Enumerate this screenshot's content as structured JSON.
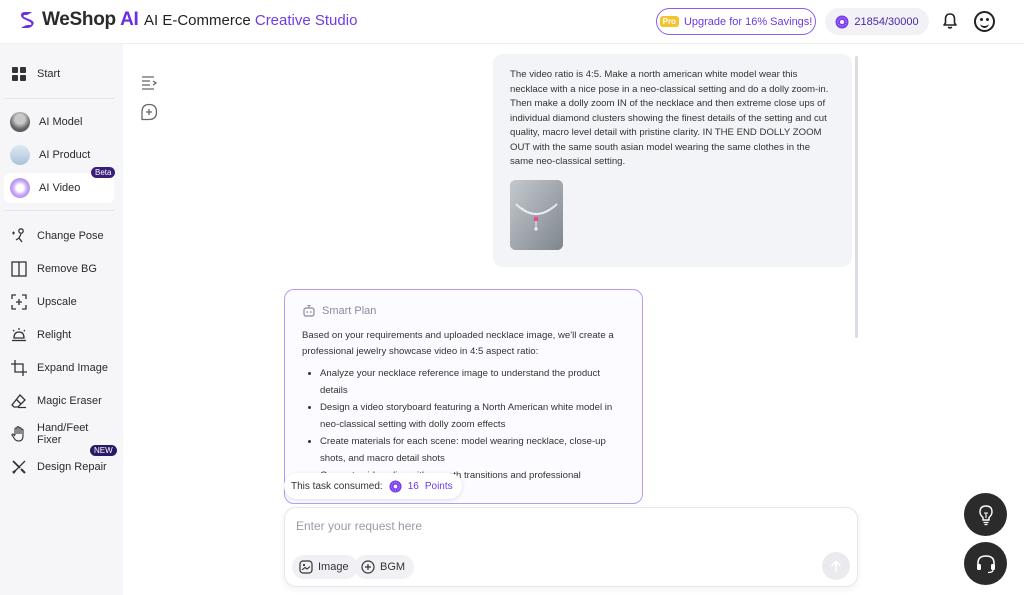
{
  "header": {
    "logo_we": "WeShop",
    "logo_ai": "AI",
    "title_main": "AI E-Commerce",
    "title_accent": "Creative Studio",
    "upgrade_pro": "Pro",
    "upgrade_label": "Upgrade for 16% Savings!",
    "points": "21854/30000"
  },
  "sidebar": {
    "start": "Start",
    "ai_model": "AI Model",
    "ai_product": "AI Product",
    "ai_video": "AI Video",
    "ai_video_badge": "Beta",
    "change_pose": "Change Pose",
    "remove_bg": "Remove BG",
    "upscale": "Upscale",
    "relight": "Relight",
    "expand_image": "Expand Image",
    "magic_eraser": "Magic Eraser",
    "hand_feet_fixer": "Hand/Feet Fixer",
    "design_repair": "Design Repair",
    "design_repair_badge": "NEW"
  },
  "chat": {
    "user_message": "The video ratio is 4:5. Make a north american white model wear this necklace with a nice pose in a neo-classical setting and do a dolly zoom-in. Then make a dolly zoom IN of the necklace and then extreme close ups of individual diamond clusters showing the finest details of the setting and cut quality, macro level detail with pristine clarity. IN THE END DOLLY ZOOM OUT with the same south asian model wearing the same clothes in the same neo-classical setting.",
    "plan_title": "Smart Plan",
    "plan_intro": "Based on your requirements and uploaded necklace image, we'll create a professional jewelry showcase video in 4:5 aspect ratio:",
    "plan_items": [
      "Analyze your necklace reference image to understand the product details",
      "Design a video storyboard featuring a North American white model in neo-classical setting with dolly zoom effects",
      "Create materials for each scene: model wearing necklace, close-up shots, and macro detail shots",
      "Generate video clips with smooth transitions and professional"
    ],
    "consumed_label": "This task consumed:",
    "consumed_points": "16",
    "consumed_unit": "Points"
  },
  "composer": {
    "placeholder": "Enter your request here",
    "image_label": "Image",
    "bgm_label": "BGM"
  },
  "colors": {
    "brand": "#6b2fe0",
    "accent": "#6f3ce6",
    "plan_border": "#b79cf2",
    "float_bg": "#2b2b2b"
  }
}
